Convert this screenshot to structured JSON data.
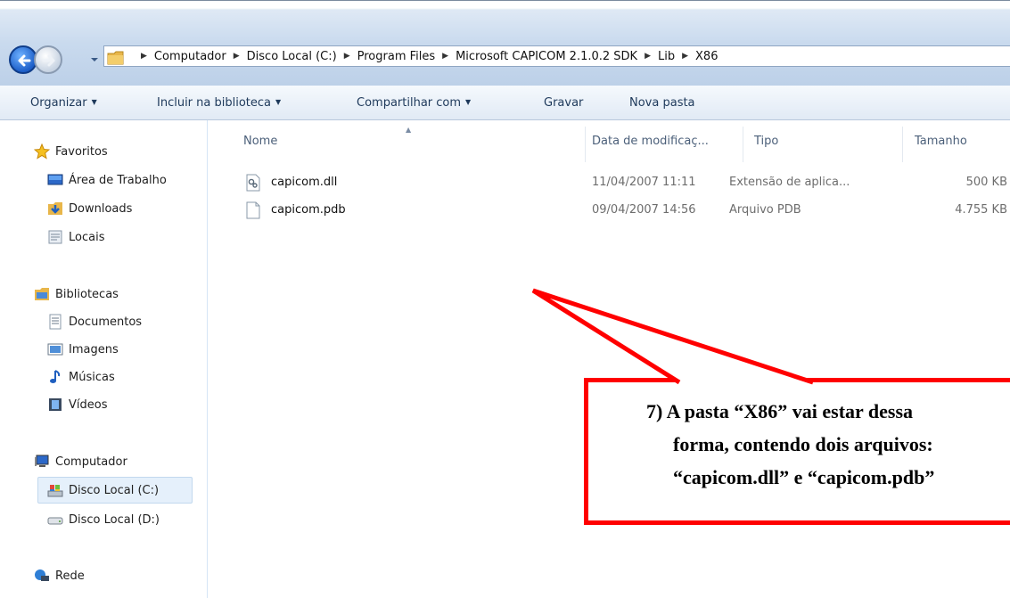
{
  "address": {
    "breadcrumbs": [
      "Computador",
      "Disco Local (C:)",
      "Program Files",
      "Microsoft CAPICOM 2.1.0.2 SDK",
      "Lib",
      "X86"
    ]
  },
  "toolbar": {
    "organize": "Organizar",
    "include": "Incluir na biblioteca",
    "share": "Compartilhar com",
    "burn": "Gravar",
    "new_folder": "Nova pasta"
  },
  "nav": {
    "favorites": "Favoritos",
    "desktop": "Área de Trabalho",
    "downloads": "Downloads",
    "places": "Locais",
    "libraries": "Bibliotecas",
    "documents": "Documentos",
    "images": "Imagens",
    "music": "Músicas",
    "videos": "Vídeos",
    "computer": "Computador",
    "disk_c": "Disco Local (C:)",
    "disk_d": "Disco Local (D:)",
    "network": "Rede"
  },
  "columns": {
    "name": "Nome",
    "date": "Data de modificaç...",
    "type": "Tipo",
    "size": "Tamanho"
  },
  "files": [
    {
      "name": "capicom.dll",
      "date": "11/04/2007 11:11",
      "type": "Extensão de aplica...",
      "size": "500 KB",
      "icon": "dll-file-icon"
    },
    {
      "name": "capicom.pdb",
      "date": "09/04/2007 14:56",
      "type": "Arquivo PDB",
      "size": "4.755 KB",
      "icon": "generic-file-icon"
    }
  ],
  "annotation": {
    "line1": "7)  A pasta “X86” vai estar dessa",
    "line2": "forma, contendo dois arquivos:",
    "line3": "“capicom.dll”  e “capicom.pdb”",
    "color": "#ff0000"
  }
}
